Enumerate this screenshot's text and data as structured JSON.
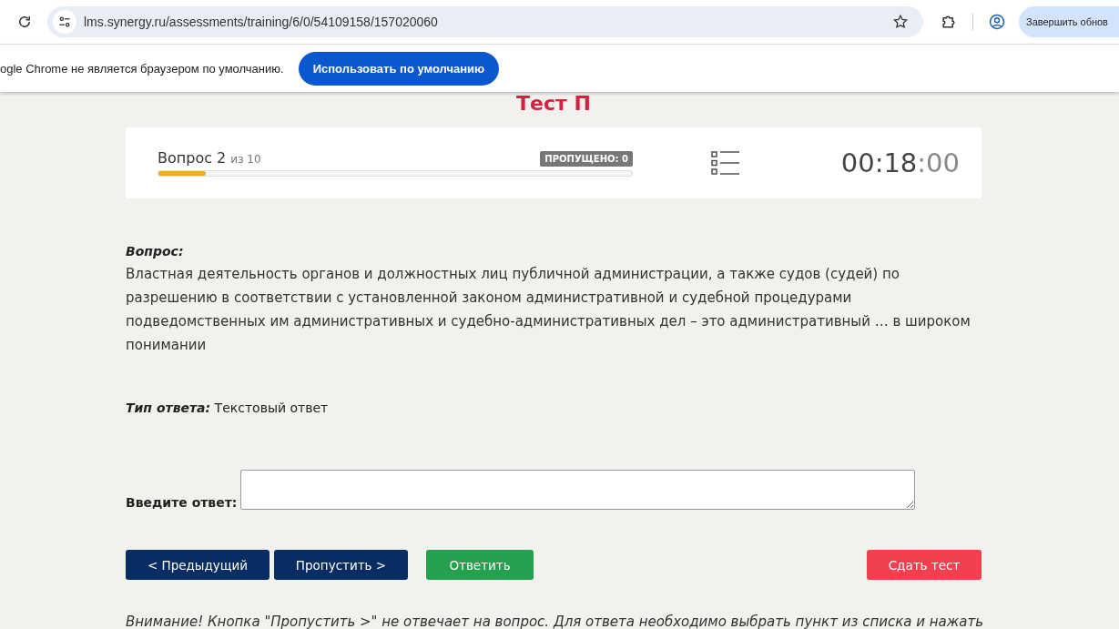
{
  "browser": {
    "url": "lms.synergy.ru/assessments/training/6/0/54109158/157020060",
    "update_button": "Завершить обнов"
  },
  "infobar": {
    "message": "ogle Chrome не является браузером по умолчанию.",
    "button": "Использовать по умолчанию"
  },
  "test": {
    "title": "Тест П"
  },
  "progress": {
    "question": "Вопрос 2",
    "of": "из 10",
    "level": 0.1,
    "skipped": "ПРОПУЩЕНО: 0",
    "timer_main": "00:18",
    "timer_sep": ":",
    "timer_sec": "00"
  },
  "question": {
    "label": "Вопрос:",
    "text": "Властная деятельность органов и должностных лиц публичной администрации, а также судов (судей) по разрешению в соответствии с установленной законом административной и судебной процедурами подведомственных им административных и судебно-административных дел – это административный … в широком понимании"
  },
  "answer_type": {
    "label": "Тип ответа:",
    "value": "Текстовый ответ"
  },
  "answer": {
    "label": "Введите ответ:"
  },
  "buttons": [
    {
      "label": "< Предыдущий",
      "kind": "nav"
    },
    {
      "label": "Пропустить >",
      "kind": "nav"
    },
    {
      "label": "Ответить",
      "kind": "answer"
    },
    {
      "label": "Сдать тест",
      "kind": "submit"
    }
  ],
  "notice": "Внимание! Кнопка \"Пропустить >\" не отвечает на вопрос. Для ответа необходимо выбрать пункт из списка и нажать"
}
